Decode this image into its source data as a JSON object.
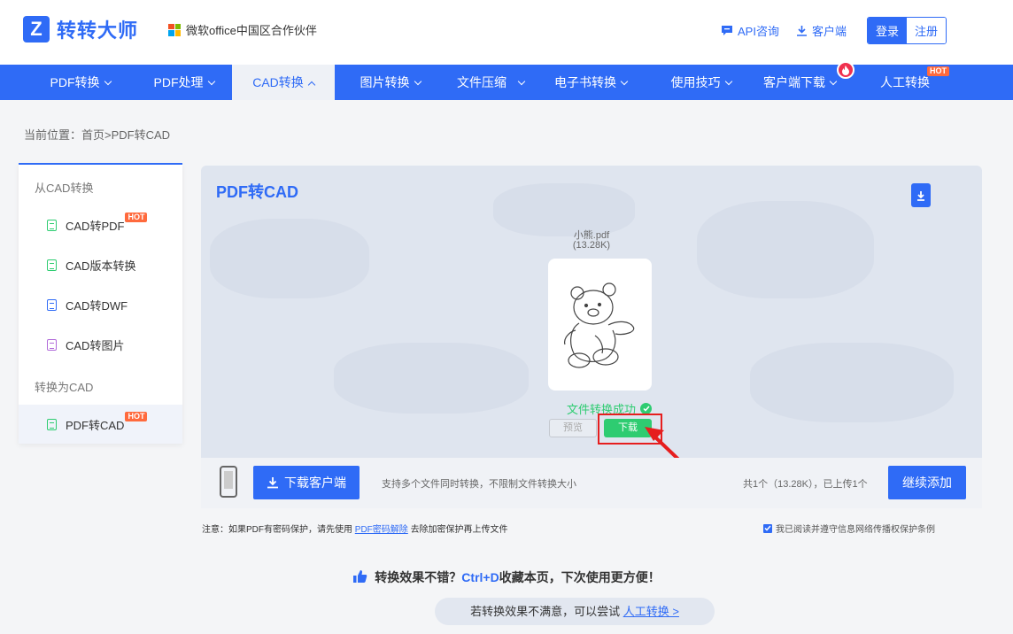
{
  "header": {
    "logo_text": "转转大师",
    "partner": "微软office中国区合作伙伴",
    "api_link": "API咨询",
    "client_link": "客户端",
    "login": "登录",
    "register": "注册"
  },
  "nav": [
    {
      "label": "PDF转换"
    },
    {
      "label": "PDF处理"
    },
    {
      "label": "CAD转换"
    },
    {
      "label": "图片转换"
    },
    {
      "label": "文件压缩"
    },
    {
      "label": "电子书转换"
    },
    {
      "label": "使用技巧"
    },
    {
      "label": "客户端下载"
    },
    {
      "label": "人工转换"
    }
  ],
  "hot_badge": "HOT",
  "breadcrumb": "当前位置：首页>PDF转CAD",
  "sidebar": {
    "group1": "从CAD转换",
    "items1": [
      "CAD转PDF",
      "CAD版本转换",
      "CAD转DWF",
      "CAD转图片"
    ],
    "group2": "转换为CAD",
    "items2": [
      "PDF转CAD"
    ],
    "icon_colors": [
      "#2ecc71",
      "#2ecc71",
      "#2f6bf6",
      "#b06ad9",
      "#2ecc71"
    ]
  },
  "panel": {
    "title": "PDF转CAD",
    "file_name": "小熊.pdf",
    "file_size": "(13.28K)",
    "status": "文件转换成功",
    "preview_btn": "预览",
    "download_btn": "下载"
  },
  "bottom_bar": {
    "client_btn": "下载客户端",
    "tip": "支持多个文件同时转换，不限制文件转换大小",
    "count": "共1个（13.28K），已上传1个",
    "add_btn": "继续添加"
  },
  "note": {
    "prefix": "注意：如果PDF有密码保护，请先使用",
    "link": "PDF密码解除",
    "suffix": "去除加密保护再上传文件"
  },
  "agreement": "我已阅读并遵守信息网络传播权保护条例",
  "promo": {
    "pre": "转换效果不错？",
    "key": "Ctrl+D",
    "post": "收藏本页，下次使用更方便！"
  },
  "manual": {
    "text": "若转换效果不满意，可以尝试",
    "link": "人工转换 >"
  },
  "colors": {
    "brand": "#2f6bf6",
    "success": "#2ecc71",
    "hot": "#ff6a3d",
    "highlight": "#e61e1e"
  }
}
